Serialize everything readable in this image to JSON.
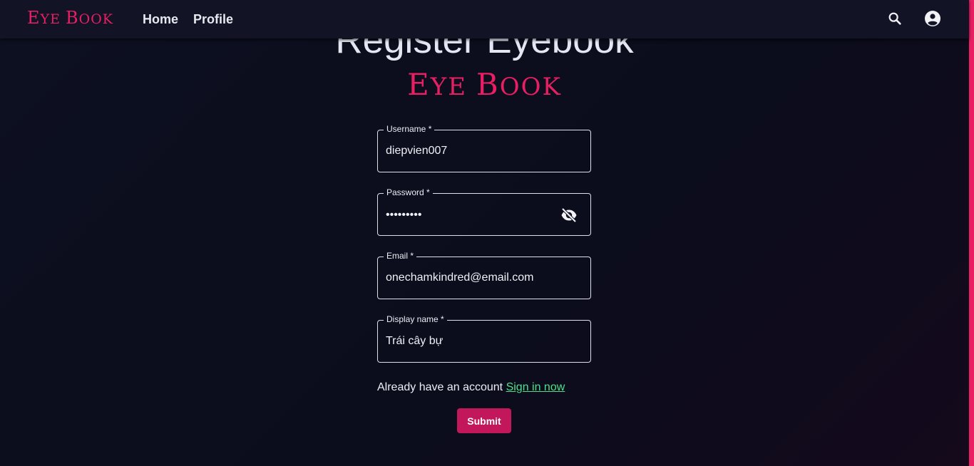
{
  "appbar": {
    "brand_big": "E",
    "brand_rest_1": "ye ",
    "brand_big_2": "B",
    "brand_rest_2": "ook",
    "nav": [
      "Home",
      "Profile"
    ],
    "search_icon": "search-icon",
    "account_icon": "account-circle-icon"
  },
  "main": {
    "heading": "Register Eyebook",
    "logo_big": "E",
    "logo_rest_1": "ye ",
    "logo_big_2": "B",
    "logo_rest_2": "ook"
  },
  "form": {
    "username": {
      "label": "Username *",
      "value": "diepvien007"
    },
    "password": {
      "label": "Password *",
      "value": "•••••••••",
      "toggle_icon": "eye-off-icon"
    },
    "email": {
      "label": "Email *",
      "value": "onechamkindred@email.com"
    },
    "display_name": {
      "label": "Display name *",
      "value": "Trái cây bự"
    },
    "account_text": "Already have an account ",
    "signin_link": "Sign in now",
    "submit_label": "Submit"
  },
  "colors": {
    "accent": "#e91e63",
    "button": "#c2185b",
    "link": "#4ee08a",
    "background": "#0c0e1e"
  }
}
